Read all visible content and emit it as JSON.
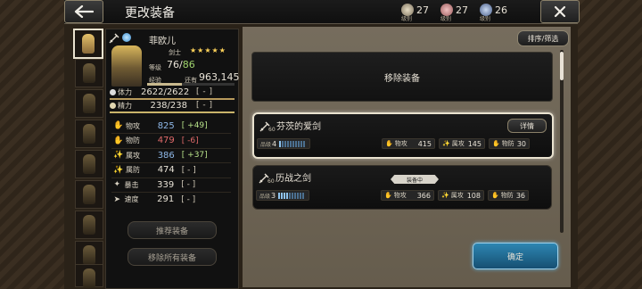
{
  "header": {
    "title": "更改装备",
    "currencies": [
      {
        "icon": "gold-tier-icon",
        "label": "级别",
        "value": "27"
      },
      {
        "icon": "silver-tier-icon",
        "label": "级别",
        "value": "27"
      },
      {
        "icon": "bronze-tier-icon",
        "label": "级别",
        "value": "26"
      }
    ]
  },
  "party": {
    "slots": 9,
    "active_index": 0
  },
  "character": {
    "name": "菲欧儿",
    "job": "剑士",
    "stars": "★★★★★",
    "level_label": "等级",
    "level": "76",
    "level_sep": "/",
    "level_max": "86",
    "exp_label": "经验",
    "exp_remaining_label": "还有",
    "exp_remaining": "963,145",
    "exp_progress": 0.4,
    "hp": {
      "label": "体力",
      "value": "2622/2622",
      "bonus": "[ - ]",
      "fill": 1.0
    },
    "sp": {
      "label": "精力",
      "value": "238/238",
      "bonus": "[ - ]",
      "fill": 1.0
    }
  },
  "stats": [
    {
      "icon": "✋",
      "label": "物攻",
      "value": "825",
      "bonus": "[ +49]",
      "kind": "up"
    },
    {
      "icon": "✋",
      "label": "物防",
      "value": "479",
      "bonus": "[ -6]",
      "kind": "down"
    },
    {
      "icon": "✨",
      "label": "属攻",
      "value": "386",
      "bonus": "[ +37]",
      "kind": "up"
    },
    {
      "icon": "✨",
      "label": "属防",
      "value": "474",
      "bonus": "[ - ]",
      "kind": "plain"
    },
    {
      "icon": "✦",
      "label": "暴击",
      "value": "339",
      "bonus": "[ - ]",
      "kind": "plain"
    },
    {
      "icon": "➤",
      "label": "速度",
      "value": "291",
      "bonus": "[ - ]",
      "kind": "plain"
    }
  ],
  "buttons": {
    "recommend": "推荐装备",
    "remove_all": "移除所有装备",
    "sort_filter": "排序/筛选",
    "remove_equipment": "移除装备",
    "confirm": "确定",
    "details": "详情"
  },
  "equipment": [
    {
      "name": "芬茨的爱剑",
      "level": "60",
      "grade_label": "品级",
      "grade": "4",
      "pips_on": 1,
      "pips_total": 10,
      "selected": true,
      "equipped_tag": "",
      "stats": [
        {
          "icon": "✋",
          "label": "物攻",
          "value": "415"
        },
        {
          "icon": "✨",
          "label": "属攻",
          "value": "145"
        },
        {
          "icon": "✋",
          "label": "物防",
          "value": "30"
        }
      ]
    },
    {
      "name": "历战之剑",
      "level": "60",
      "grade_label": "品级",
      "grade": "3",
      "pips_on": 4,
      "pips_total": 10,
      "selected": false,
      "equipped_tag": "装备中",
      "stats": [
        {
          "icon": "✋",
          "label": "物攻",
          "value": "366"
        },
        {
          "icon": "✨",
          "label": "属攻",
          "value": "108"
        },
        {
          "icon": "✋",
          "label": "物防",
          "value": "36"
        }
      ]
    }
  ]
}
